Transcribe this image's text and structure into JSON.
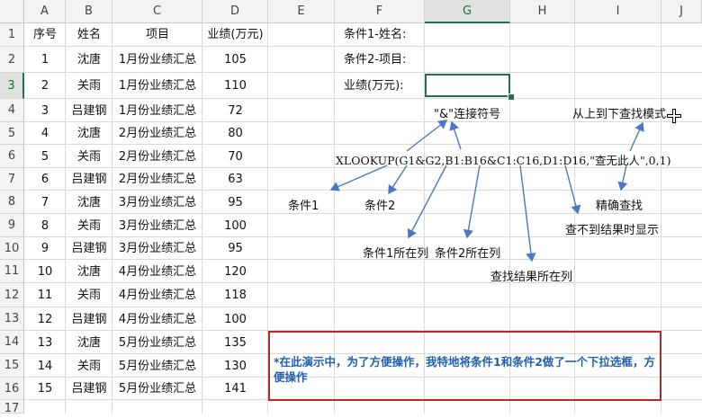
{
  "columns": [
    "A",
    "B",
    "C",
    "D",
    "E",
    "F",
    "G",
    "H",
    "I",
    "J"
  ],
  "row_numbers": [
    "1",
    "2",
    "3",
    "4",
    "5",
    "6",
    "7",
    "8",
    "9",
    "10",
    "11",
    "12",
    "13",
    "14",
    "15",
    "16",
    "17"
  ],
  "selected_column": "G",
  "selected_row": "3",
  "table": {
    "headers": [
      "序号",
      "姓名",
      "项目",
      "业绩(万元)"
    ],
    "rows": [
      [
        "1",
        "沈唐",
        "1月份业绩汇总",
        "105"
      ],
      [
        "2",
        "关雨",
        "1月份业绩汇总",
        "110"
      ],
      [
        "3",
        "吕建钢",
        "1月份业绩汇总",
        "72"
      ],
      [
        "4",
        "沈唐",
        "2月份业绩汇总",
        "80"
      ],
      [
        "5",
        "关雨",
        "2月份业绩汇总",
        "70"
      ],
      [
        "6",
        "吕建钢",
        "2月份业绩汇总",
        "63"
      ],
      [
        "7",
        "沈唐",
        "3月份业绩汇总",
        "95"
      ],
      [
        "8",
        "关雨",
        "3月份业绩汇总",
        "100"
      ],
      [
        "9",
        "吕建钢",
        "3月份业绩汇总",
        "95"
      ],
      [
        "10",
        "沈唐",
        "4月份业绩汇总",
        "120"
      ],
      [
        "11",
        "关雨",
        "4月份业绩汇总",
        "118"
      ],
      [
        "12",
        "吕建钢",
        "4月份业绩汇总",
        "100"
      ],
      [
        "13",
        "沈唐",
        "5月份业绩汇总",
        "135"
      ],
      [
        "14",
        "关雨",
        "5月份业绩汇总",
        "130"
      ],
      [
        "15",
        "吕建钢",
        "5月份业绩汇总",
        "141"
      ]
    ]
  },
  "criteria": {
    "label1": "条件1-姓名:",
    "label2": "条件2-项目:",
    "label3": "业绩(万元):"
  },
  "annotations": {
    "ampersand": "\"&\"连接符号",
    "top_down": "从上到下查找模式",
    "formula": "XLOOKUP(G1&G2,B1:B16&C1:C16,D1:D16,\"查无此人\",0,1)",
    "cond1": "条件1",
    "cond2": "条件2",
    "exact": "精确查找",
    "not_found": "查不到结果时显示",
    "cond1_col": "条件1所在列",
    "cond2_col": "条件2所在列",
    "result_col": "查找结果所在列"
  },
  "note": "*在此演示中，为了方便操作，我特地将条件1和条件2做了一个下拉选框，方便操作",
  "colors": {
    "accent": "#217346",
    "arrow": "#4a78c2",
    "note_border": "#b3282d",
    "note_text": "#1f5fb4"
  }
}
